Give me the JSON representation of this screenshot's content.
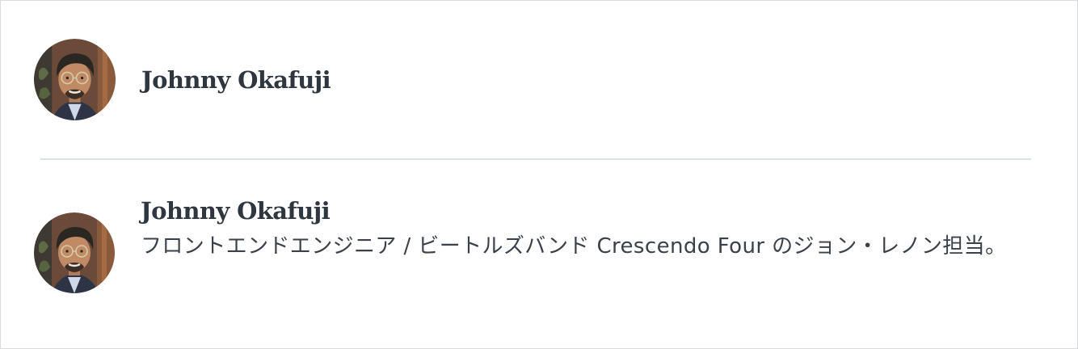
{
  "author_compact": {
    "name": "Johnny Okafuji",
    "avatar_icon": "person-photo-avatar"
  },
  "author_full": {
    "name": "Johnny Okafuji",
    "bio": "フロントエンドエンジニア / ビートルズバンド Crescendo Four のジョン・レノン担当。",
    "avatar_icon": "person-photo-avatar"
  },
  "colors": {
    "text": "#333a44",
    "divider": "#dbe3e8",
    "border": "#d8dde2"
  }
}
